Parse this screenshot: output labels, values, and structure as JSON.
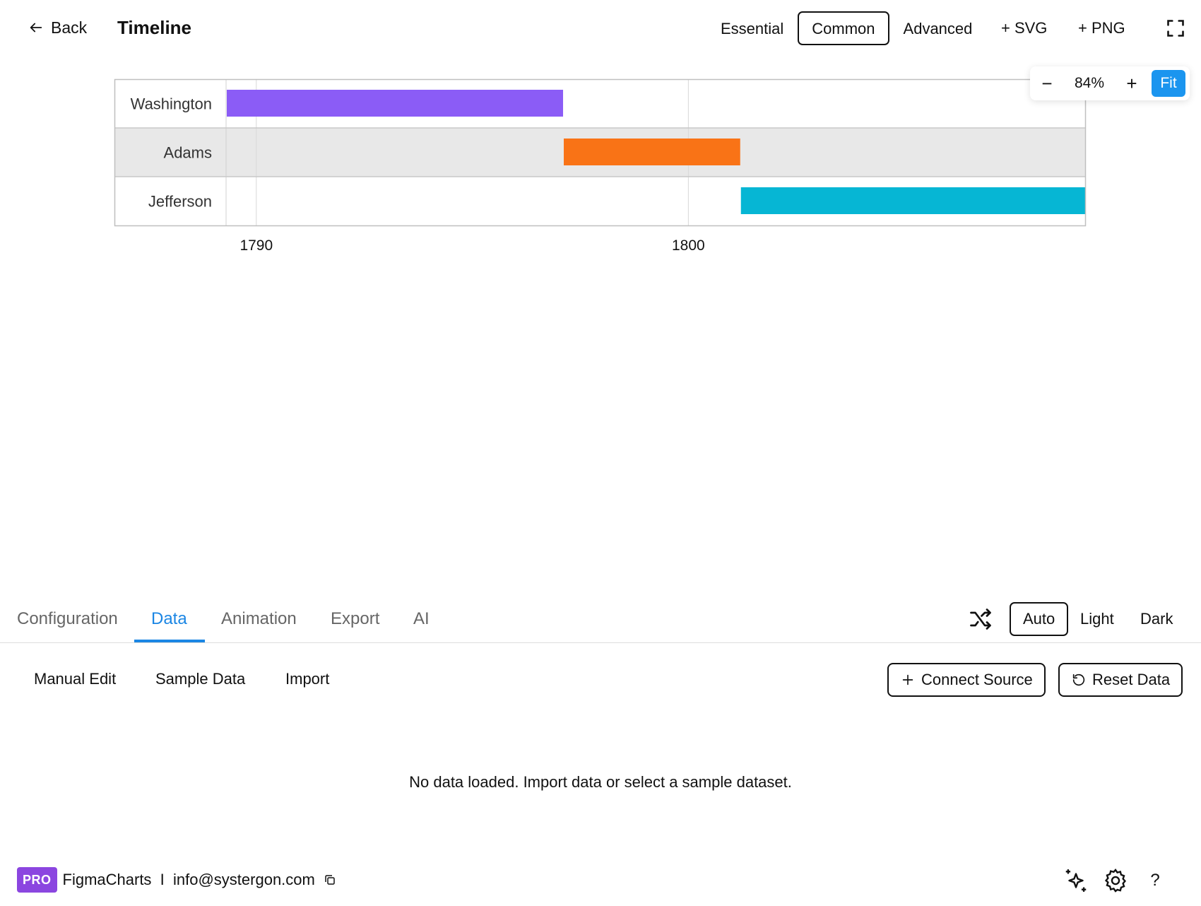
{
  "header": {
    "back_label": "Back",
    "title": "Timeline",
    "levels": [
      "Essential",
      "Common",
      "Advanced"
    ],
    "active_level": "Common",
    "export_svg": "+ SVG",
    "export_png": "+ PNG"
  },
  "zoom": {
    "minus": "−",
    "value": "84%",
    "plus": "+",
    "fit": "Fit"
  },
  "chart_data": {
    "type": "bar",
    "subtype": "timeline",
    "categories": [
      "Washington",
      "Adams",
      "Jefferson"
    ],
    "series": [
      {
        "category": "Washington",
        "start": 1789.3,
        "end": 1797.1,
        "color": "#8b5cf6"
      },
      {
        "category": "Adams",
        "start": 1797.1,
        "end": 1801.2,
        "color": "#f97316"
      },
      {
        "category": "Jefferson",
        "start": 1801.2,
        "end": 1809.2,
        "color": "#06b6d4"
      }
    ],
    "x_ticks": [
      1790,
      1800
    ],
    "xlim": [
      1789.3,
      1809.2
    ],
    "grid": true,
    "row_bands": [
      "#ffffff",
      "#e8e8e8",
      "#ffffff"
    ]
  },
  "tabs": {
    "items": [
      "Configuration",
      "Data",
      "Animation",
      "Export",
      "AI"
    ],
    "active": "Data"
  },
  "theme": {
    "options": [
      "Auto",
      "Light",
      "Dark"
    ],
    "active": "Auto"
  },
  "data_panel": {
    "subtabs": [
      "Manual Edit",
      "Sample Data",
      "Import"
    ],
    "connect_source": "Connect Source",
    "reset_data": "Reset Data",
    "empty_message": "No data loaded. Import data or select a sample dataset."
  },
  "footer": {
    "badge": "PRO",
    "brand": "FigmaCharts  I  info@systergon.com"
  },
  "colors": {
    "accent": "#1b95ef",
    "tab_active": "#1b86e4",
    "pro": "#8b46e0"
  },
  "icons": [
    "arrow-left-icon",
    "fullscreen-icon",
    "shuffle-icon",
    "plus-icon",
    "reset-icon",
    "copy-icon",
    "sparkle-icon",
    "gear-icon",
    "help-icon"
  ]
}
